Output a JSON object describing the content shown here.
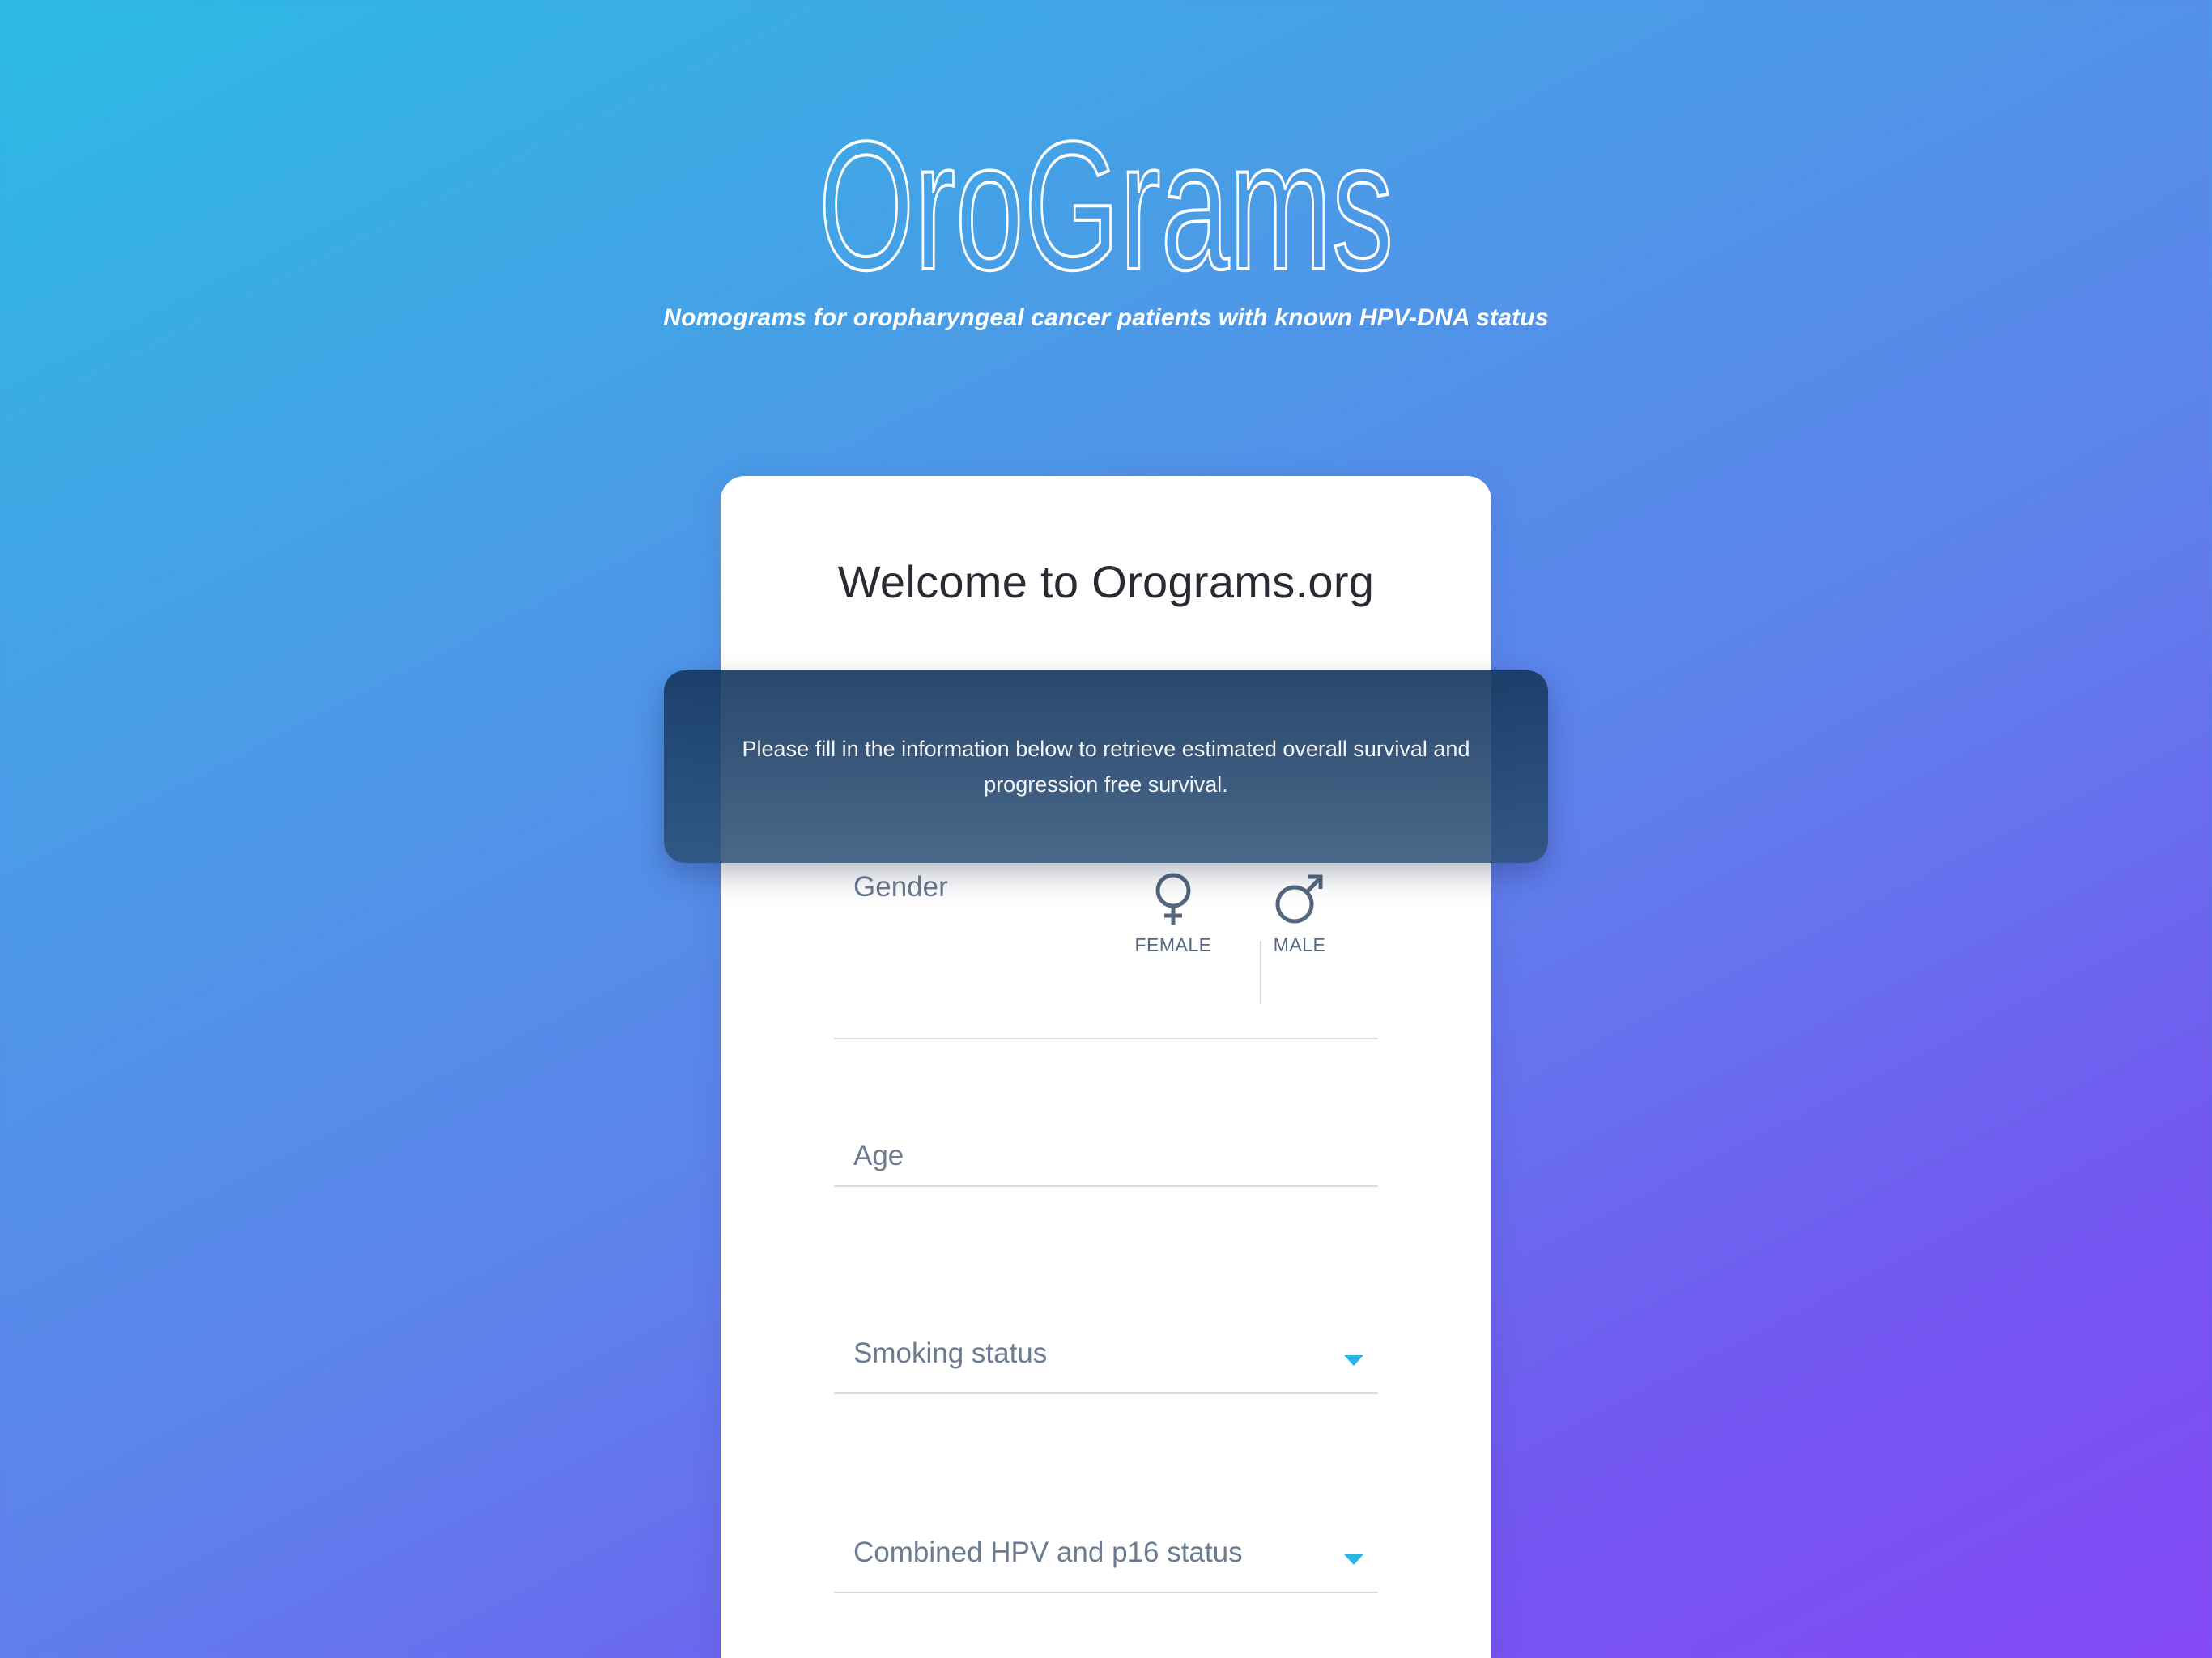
{
  "brand": {
    "logo_text": "OroGrams",
    "tagline": "Nomograms for oropharyngeal cancer patients with known HPV-DNA status"
  },
  "card": {
    "welcome": "Welcome to Orograms.org"
  },
  "banner": {
    "text": "Please fill in the information below to retrieve estimated overall survival and progression free survival."
  },
  "form": {
    "gender": {
      "label": "Gender",
      "options": [
        {
          "label": "FEMALE",
          "icon": "female-symbol-icon"
        },
        {
          "label": "MALE",
          "icon": "male-symbol-icon"
        }
      ]
    },
    "age": {
      "label": "Age",
      "value": ""
    },
    "smoking": {
      "label": "Smoking status",
      "icon": "caret-down-icon"
    },
    "hpv": {
      "label": "Combined HPV and p16 status",
      "icon": "caret-down-icon"
    }
  },
  "colors": {
    "gradient_start": "#2bbbe3",
    "gradient_end": "#8449f5",
    "banner": "#1f4470",
    "label": "#6b7b90",
    "accent_caret": "#2bb6e6"
  }
}
